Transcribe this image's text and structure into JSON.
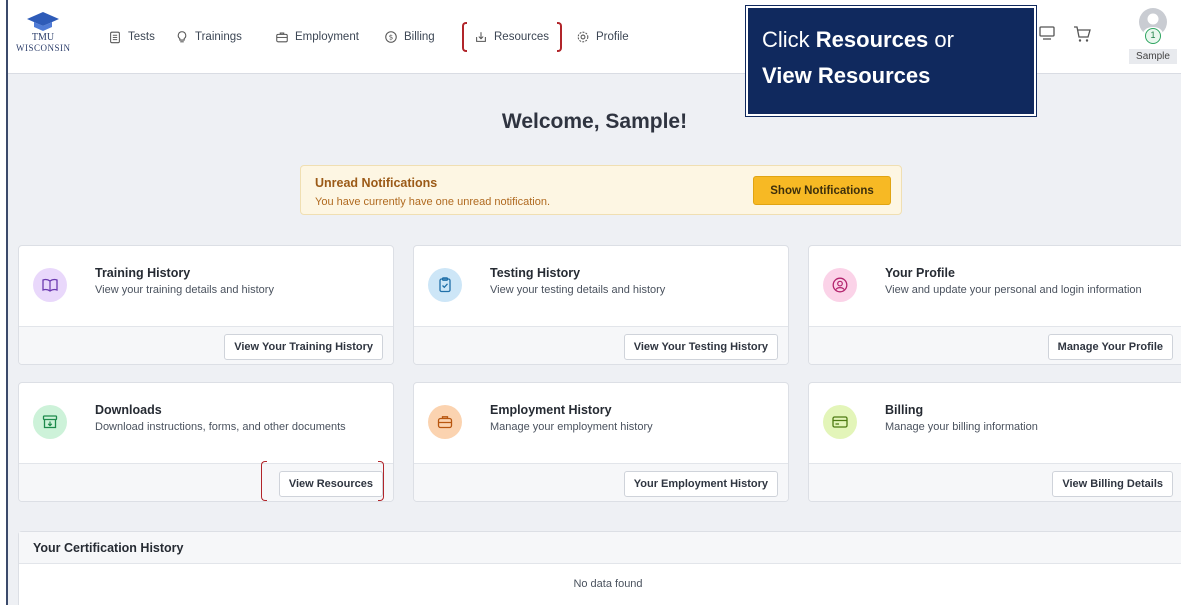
{
  "logo": {
    "line1": "TMU",
    "line2": "WISCONSIN"
  },
  "nav": [
    {
      "label": "Tests",
      "icon": "clipboard-icon"
    },
    {
      "label": "Trainings",
      "icon": "lightbulb-icon"
    },
    {
      "label": "Employment",
      "icon": "briefcase-icon"
    },
    {
      "label": "Billing",
      "icon": "dollar-icon"
    },
    {
      "label": "Resources",
      "icon": "download-icon"
    },
    {
      "label": "Profile",
      "icon": "gear-icon"
    }
  ],
  "user": {
    "name": "Sample",
    "badge_count": "1"
  },
  "callout": {
    "part1": "Click ",
    "bold1": "Resources",
    "part2": " or",
    "bold2": "View Resources"
  },
  "welcome": "Welcome, Sample!",
  "notification": {
    "title": "Unread Notifications",
    "message": "You have currently have one unread notification.",
    "button": "Show Notifications"
  },
  "cards": [
    {
      "title": "Training History",
      "desc": "View your training details and history",
      "button": "View Your Training History",
      "icon": "book-icon",
      "color": "#e9d8fb"
    },
    {
      "title": "Testing History",
      "desc": "View your testing details and history",
      "button": "View Your Testing History",
      "icon": "clipboard-check-icon",
      "color": "#cde6f7"
    },
    {
      "title": "Your Profile",
      "desc": "View and update your personal and login information",
      "button": "Manage Your Profile",
      "icon": "user-circle-icon",
      "color": "#fbd3e8"
    },
    {
      "title": "Downloads",
      "desc": "Download instructions, forms, and other documents",
      "button": "View Resources",
      "icon": "archive-download-icon",
      "color": "#cdf2d9"
    },
    {
      "title": "Employment History",
      "desc": "Manage your employment history",
      "button": "Your Employment History",
      "icon": "briefcase-icon",
      "color": "#fbd3b0"
    },
    {
      "title": "Billing",
      "desc": "Manage your billing information",
      "button": "View Billing Details",
      "icon": "credit-card-icon",
      "color": "#e3f5b9"
    }
  ],
  "certification": {
    "title": "Your Certification History",
    "empty": "No data found"
  }
}
